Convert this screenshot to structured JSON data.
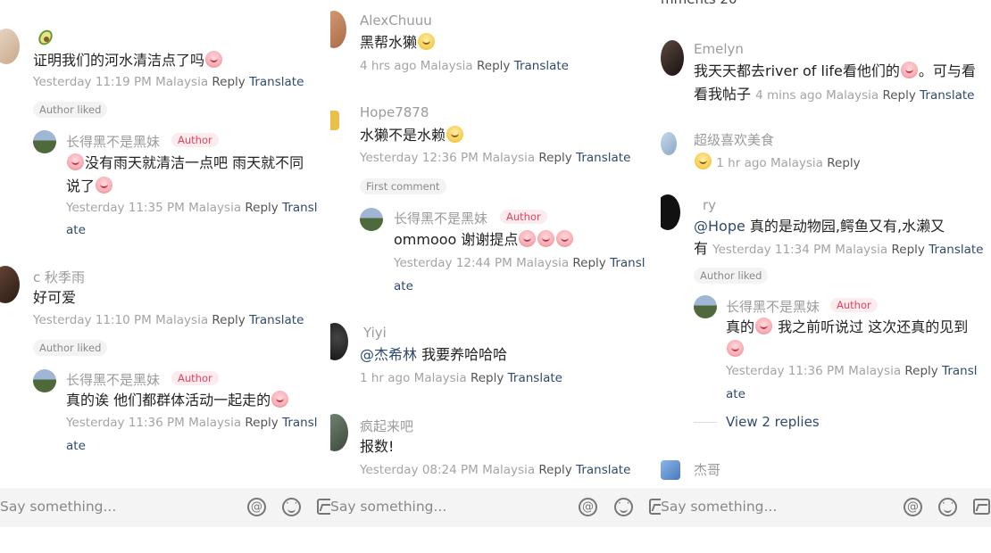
{
  "panel1": {
    "c1_text": "证明我们的河水清洁点了吗",
    "c1_meta": "Yesterday 11:19 PM Malaysia",
    "c1_pill": "Author liked",
    "r1_name": "长得黑不是黑妹",
    "r1_badge": "Author",
    "r1_text_a": "没有雨天就清洁一点吧 雨天就不同",
    "r1_text_b": "说了",
    "r1_meta": "Yesterday 11:35 PM Malaysia",
    "c2_name": "c 秋季雨",
    "c2_text": "好可爱",
    "c2_meta": "Yesterday 11:10 PM Malaysia",
    "c2_pill": "Author liked",
    "r2_name": "长得黑不是黑妹",
    "r2_badge": "Author",
    "r2_text": "真的诶 他们都群体活动一起走的",
    "r2_meta": "Yesterday 11:36 PM Malaysia",
    "reply": "Reply",
    "translate": "Translate",
    "transl_a": "Transl",
    "transl_b": "ate"
  },
  "panel2": {
    "c1_name": "AlexChuuu",
    "c1_text": "黑帮水獭",
    "c1_meta": "4 hrs ago Malaysia",
    "c2_name": "Hope7878",
    "c2_text": "水獭不是水赖",
    "c2_meta": "Yesterday 12:36 PM Malaysia",
    "c2_pill": "First comment",
    "r1_name": "长得黑不是黑妹",
    "r1_badge": "Author",
    "r1_text": "ommooo 谢谢提点",
    "r1_meta": "Yesterday 12:44 PM Malaysia",
    "c3_name": "Yiyi",
    "c3_mention": "@杰希林",
    "c3_text": "我要养哈哈哈",
    "c3_meta": "1 hr ago Malaysia",
    "c4_name": "疯起来吧",
    "c4_text": "报数!",
    "c4_meta": "Yesterday 08:24 PM Malaysia",
    "reply": "Reply",
    "translate": "Translate",
    "transl_a": "Transl",
    "transl_b": "ate"
  },
  "panel3": {
    "header": "mments 20",
    "c1_name": "Emelyn",
    "c1_text_a": "我天天都去river of life看他们的",
    "c1_text_b": "。可与看",
    "c1_text_c": "看我帖子",
    "c1_meta": "4 mins ago Malaysia",
    "c2_name": "超级喜欢美食",
    "c2_meta": "1 hr ago Malaysia",
    "c3_name": "ry",
    "c3_mention": "@Hope",
    "c3_text_a": "真的是动物园,鳄鱼又有,水濑又",
    "c3_text_b": "有",
    "c3_meta": "Yesterday 11:34 PM Malaysia",
    "c3_pill": "Author liked",
    "r1_name": "长得黑不是黑妹",
    "r1_badge": "Author",
    "r1_text_a": "真的",
    "r1_text_b": "我之前听说过 这次还真的见到",
    "r1_meta": "Yesterday 11:36 PM Malaysia",
    "view_replies": "View 2 replies",
    "c4_name": "杰哥",
    "reply": "Reply",
    "translate": "Translate",
    "transl_a": "Transl",
    "transl_b": "ate"
  },
  "input": {
    "placeholder": "Say something..."
  },
  "icons": [
    "at-icon",
    "emoji-icon",
    "image-icon"
  ],
  "colors": {
    "author_badge": "#e0445c",
    "translate": "#2f4a6d",
    "bar": "#f4f4f4"
  }
}
